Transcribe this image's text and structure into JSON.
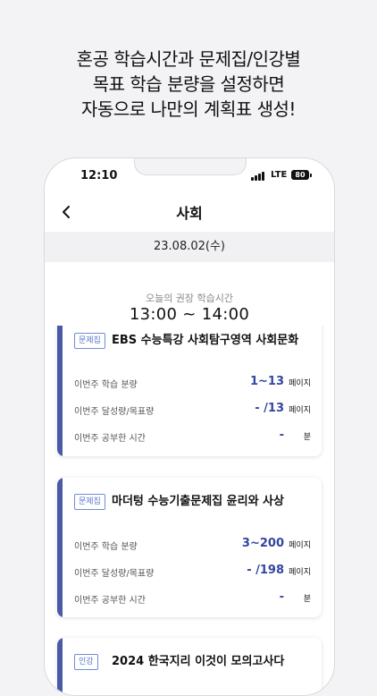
{
  "headline": {
    "lines": [
      "혼공 학습시간과 문제집/인강별",
      "목표 학습 분량을 설정하면",
      "자동으로 나만의 계획표 생성!"
    ]
  },
  "status_bar": {
    "time": "12:10",
    "network": "LTE",
    "battery": "80"
  },
  "nav": {
    "back_icon": "chevron-left-icon",
    "title": "사회"
  },
  "date": "23.08.02(수)",
  "recommend": {
    "label": "오늘의 권장 학습시간",
    "time": "13:00 ~ 14:00"
  },
  "row_labels": {
    "amount": "이번주 학습 분량",
    "progress": "이번주 달성량/목표량",
    "study_time": "이번주 공부한 시간"
  },
  "cards": [
    {
      "tag": "문제집",
      "title": "EBS 수능특강 사회탐구영역 사회문화",
      "amount": "1~13",
      "amount_unit": "페이지",
      "progress": "- /13",
      "progress_unit": "페이지",
      "study_time": "-",
      "study_time_unit": "분"
    },
    {
      "tag": "문제집",
      "title": "마더텅 수능기출문제집 윤리와 사상",
      "amount": "3~200",
      "amount_unit": "페이지",
      "progress": "- /198",
      "progress_unit": "페이지",
      "study_time": "-",
      "study_time_unit": "분"
    },
    {
      "tag": "인강",
      "title": "2024 한국지리 이것이 모의고사다"
    }
  ],
  "colors": {
    "accent": "#4a5aa8",
    "value": "#3346a0",
    "tag_border": "#6f8ed6",
    "background": "#f3f3f5"
  }
}
